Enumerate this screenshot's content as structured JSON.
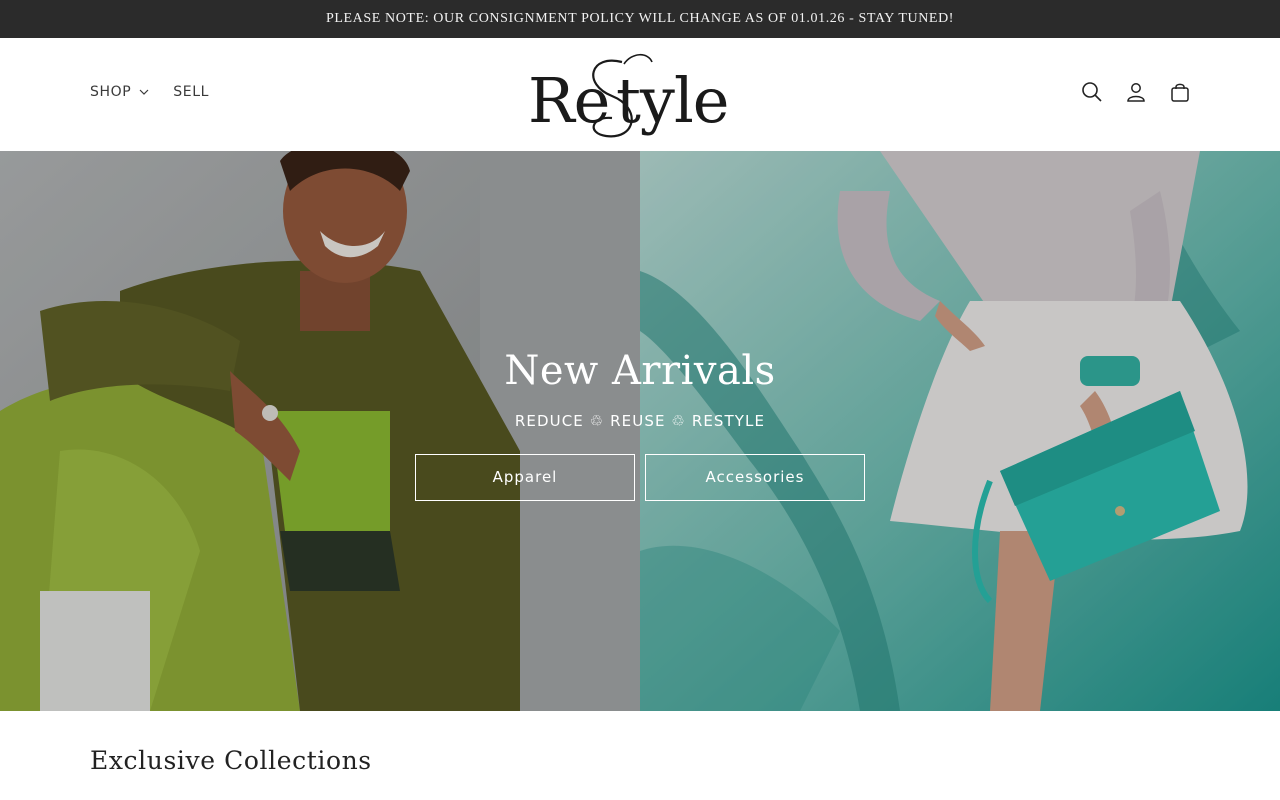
{
  "announcement": {
    "text": "PLEASE NOTE: OUR CONSIGNMENT POLICY WILL CHANGE AS OF 01.01.26 - STAY TUNED!"
  },
  "header": {
    "nav_left": [
      {
        "label": "SHOP",
        "has_dropdown": true
      },
      {
        "label": "SELL",
        "has_dropdown": false
      }
    ],
    "logo_text": "ReStyle",
    "icons": [
      "search-icon",
      "account-icon",
      "cart-icon"
    ]
  },
  "hero": {
    "title": "New Arrivals",
    "subtitle": "REDUCE ♲ REUSE ♲ RESTYLE",
    "buttons": [
      {
        "label": "Apparel"
      },
      {
        "label": "Accessories"
      }
    ]
  },
  "collections": {
    "title": "Exclusive Collections"
  },
  "colors": {
    "announcement_bg": "#2b2b2b",
    "text_dark": "#1a1a1a",
    "hero_teal": "#1aa39a",
    "hero_olive": "#6b6a2a",
    "hero_lime": "#a3c93a"
  }
}
